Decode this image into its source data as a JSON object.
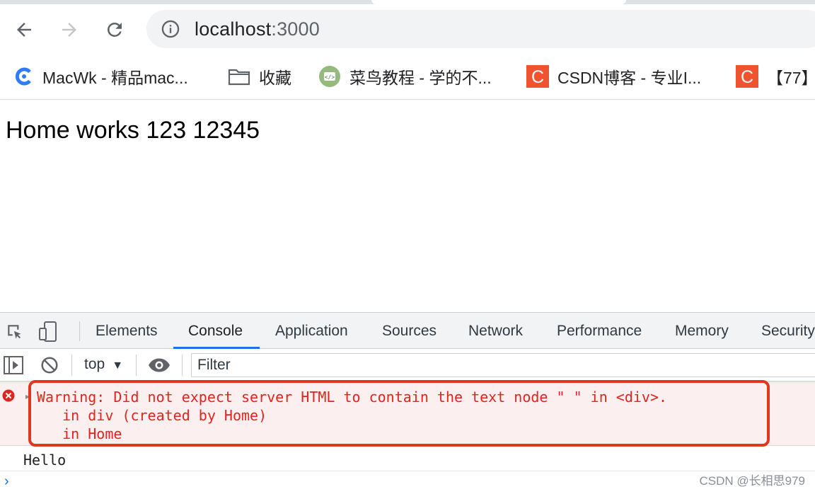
{
  "browser": {
    "url_host": "localhost",
    "url_port": ":3000",
    "bookmarks": [
      {
        "label": "MacWk - 精品mac...",
        "icon": "macwk-logo-icon"
      },
      {
        "label": "收藏",
        "icon": "folder-icon"
      },
      {
        "label": "菜鸟教程 - 学的不...",
        "icon": "runoob-logo-icon"
      },
      {
        "label": "CSDN博客 - 专业I...",
        "icon": "csdn-logo-icon"
      },
      {
        "label": "【77】",
        "icon": "csdn-logo-icon"
      }
    ]
  },
  "page": {
    "heading": "Home works 123 12345"
  },
  "devtools": {
    "tabs": [
      "Elements",
      "Console",
      "Application",
      "Sources",
      "Network",
      "Performance",
      "Memory",
      "Security"
    ],
    "active_tab": "Console",
    "context_label": "top",
    "filter_placeholder": "Filter",
    "messages": {
      "warning_lines": [
        "Warning: Did not expect server HTML to contain the text node \" \" in <div>.",
        "   in div (created by Home)",
        "   in Home"
      ],
      "log": "Hello"
    }
  },
  "watermark": "CSDN @长相思979",
  "colors": {
    "accent": "#1a73e8",
    "error": "#e0241e",
    "highlight_border": "#e0381e",
    "csdn": "#f0532f"
  }
}
